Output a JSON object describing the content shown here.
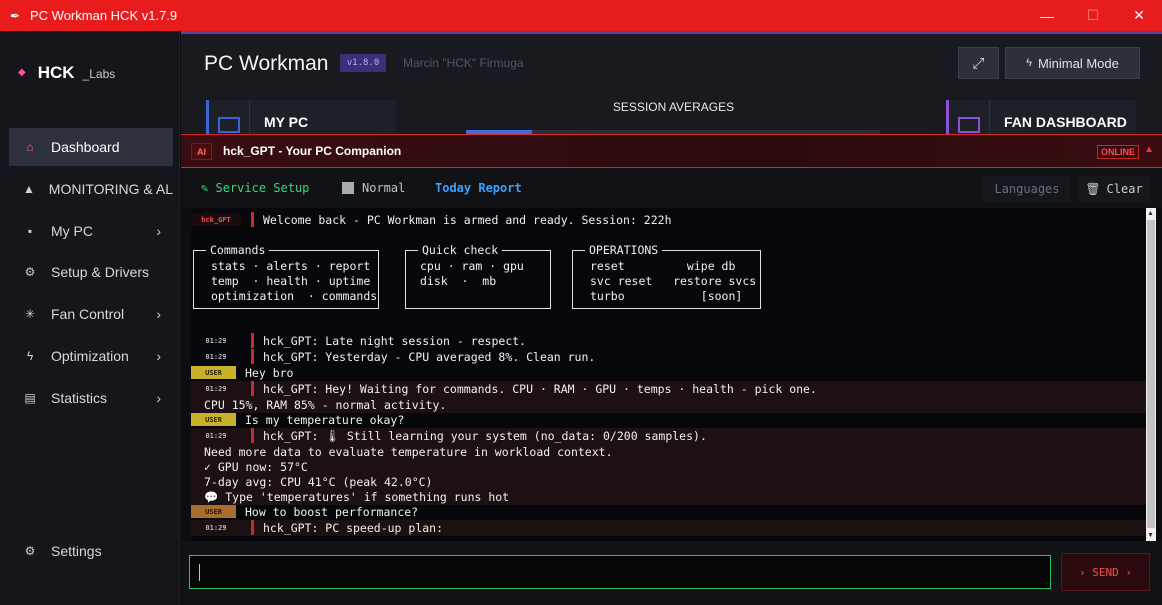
{
  "window": {
    "title": "PC Workman HCK  v1.7.9",
    "minimize": "—",
    "maximize": "☐",
    "close": "✕"
  },
  "sidebar": {
    "brand": "HCK",
    "brand_sub": "_Labs",
    "items": [
      {
        "label": "Dashboard",
        "icon": "home-icon",
        "glyph": "⌂",
        "active": true
      },
      {
        "label": "MONITORING & AL",
        "icon": "warning-icon",
        "glyph": "▲"
      },
      {
        "label": "My PC",
        "icon": "pc-icon",
        "glyph": "▪",
        "chevron": "›"
      },
      {
        "label": "Setup & Drivers",
        "icon": "gear-icon",
        "glyph": "⚙"
      },
      {
        "label": "Fan Control",
        "icon": "fan-icon",
        "glyph": "✳",
        "chevron": "›"
      },
      {
        "label": "Optimization",
        "icon": "bolt-icon",
        "glyph": "ϟ",
        "chevron": "›"
      },
      {
        "label": "Statistics",
        "icon": "stats-icon",
        "glyph": "▤",
        "chevron": "›"
      }
    ],
    "settings": {
      "label": "Settings",
      "icon": "gear-icon",
      "glyph": "⚙"
    }
  },
  "header": {
    "title": "PC Workman",
    "version": "v1.8.0",
    "author": "Marcin \"HCK\" Firmuga",
    "expand_glyph": "⤢",
    "minimal_mode": "Minimal Mode",
    "bolt": "ϟ",
    "cards": {
      "my_pc": "MY PC",
      "fan_dashboard": "FAN DASHBOARD"
    },
    "session_averages": "SESSION AVERAGES",
    "session_progress": 0.16
  },
  "gpt": {
    "badge": "AI",
    "title": "hck_GPT  -  Your PC Companion",
    "status": "ONLINE",
    "collapse": "▲"
  },
  "toolbar": {
    "service_setup": "Service Setup",
    "service_icon": "✎",
    "normal": "Normal",
    "today_report": "Today Report",
    "languages": "Languages",
    "clear": "Clear",
    "clear_icon": "🗑"
  },
  "chat": {
    "welcome_tag": "hck_GPT",
    "welcome": "Welcome back - PC Workman is armed and ready.  Session: 222h",
    "commands": {
      "title": "Commands",
      "lines": [
        "stats · alerts · report",
        "temp  · health · uptime",
        "optimization  · commands"
      ]
    },
    "quick": {
      "title": "Quick check",
      "lines": [
        "cpu · ram · gpu",
        "disk  ·  mb"
      ]
    },
    "operations": {
      "title": "OPERATIONS",
      "lines": [
        "reset         wipe db",
        "svc reset   restore svcs",
        "turbo           [soon]"
      ]
    },
    "messages": [
      {
        "kind": "bot",
        "time": "01:29",
        "text": "hck_GPT: Late night session - respect."
      },
      {
        "kind": "bot",
        "time": "01:29",
        "text": "hck_GPT: Yesterday - CPU averaged 8%. Clean run."
      },
      {
        "kind": "user",
        "tag": "USER",
        "text": "Hey bro"
      },
      {
        "kind": "bot",
        "time": "01:29",
        "text": "hck_GPT: Hey! Waiting for commands. CPU · RAM · GPU · temps · health - pick one.",
        "bg": true
      },
      {
        "kind": "cont",
        "text": "CPU 15%, RAM 85% - normal activity.",
        "bg": true
      },
      {
        "kind": "user",
        "tag": "USER",
        "text": "Is my temperature okay?"
      },
      {
        "kind": "bot",
        "time": "01:29",
        "text": "hck_GPT: 🌡 Still learning your system (no_data: 0/200 samples).",
        "bg": true
      },
      {
        "kind": "cont",
        "text": "Need more data to evaluate temperature in workload context.",
        "bg": true
      },
      {
        "kind": "cont",
        "text": "✓ GPU now: 57°C",
        "bg": true
      },
      {
        "kind": "cont",
        "text": "7-day avg: CPU 41°C (peak 42.0°C)",
        "bg": true
      },
      {
        "kind": "cont",
        "text": "💬 Type 'temperatures' if something runs hot",
        "bg": true
      },
      {
        "kind": "user2",
        "tag": "USER",
        "text": "How to boost performance?"
      },
      {
        "kind": "bot",
        "time": "01:29",
        "text": "hck_GPT: PC speed-up plan:",
        "bg": true
      }
    ]
  },
  "input": {
    "value": "",
    "send": "› SEND ›"
  }
}
